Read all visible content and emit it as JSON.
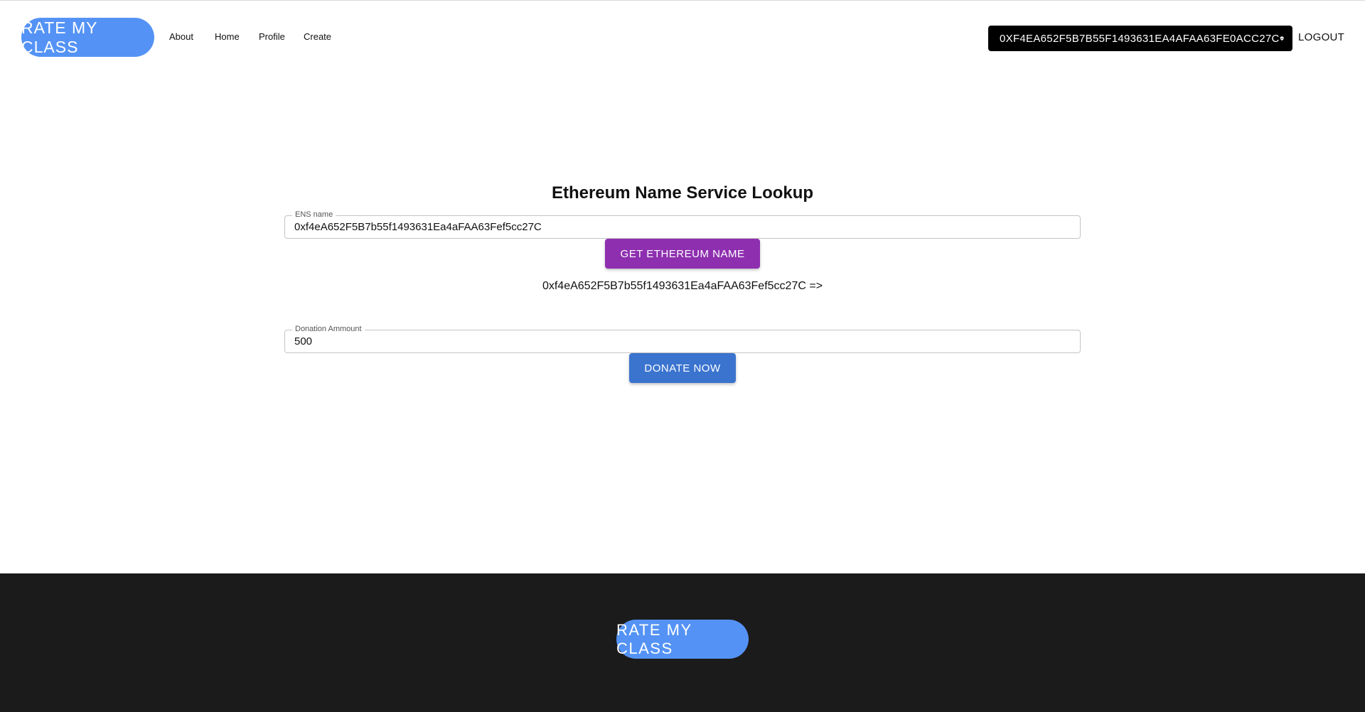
{
  "header": {
    "logo_text": "RATE MY CLASS",
    "nav": [
      {
        "label": "About"
      },
      {
        "label": "Home"
      },
      {
        "label": "Profile"
      },
      {
        "label": "Create"
      }
    ],
    "wallet_address": "0XF4EA652F5B7B55F1493631EA4AFAA63FE0ACC27C",
    "logout_label": "LOGOUT"
  },
  "main": {
    "title": "Ethereum Name Service Lookup",
    "ens_field": {
      "label": "ENS name",
      "value": "0xf4eA652F5B7b55f1493631Ea4aFAA63Fef5cc27C"
    },
    "get_name_button": "GET ETHEREUM NAME",
    "lookup_result": "0xf4eA652F5B7b55f1493631Ea4aFAA63Fef5cc27C =>",
    "donation_field": {
      "label": "Donation Ammount",
      "value": "500"
    },
    "donate_button": "DONATE NOW"
  },
  "footer": {
    "logo_text": "RATE MY CLASS"
  },
  "colors": {
    "logo_blue": "#5493f5",
    "purple_button": "#8e2fb0",
    "blue_button": "#3b74cf",
    "footer_bg": "#1c1b1b",
    "wallet_bg": "#000000"
  },
  "icons": {
    "wallet_badge": "verified-shield-icon"
  }
}
